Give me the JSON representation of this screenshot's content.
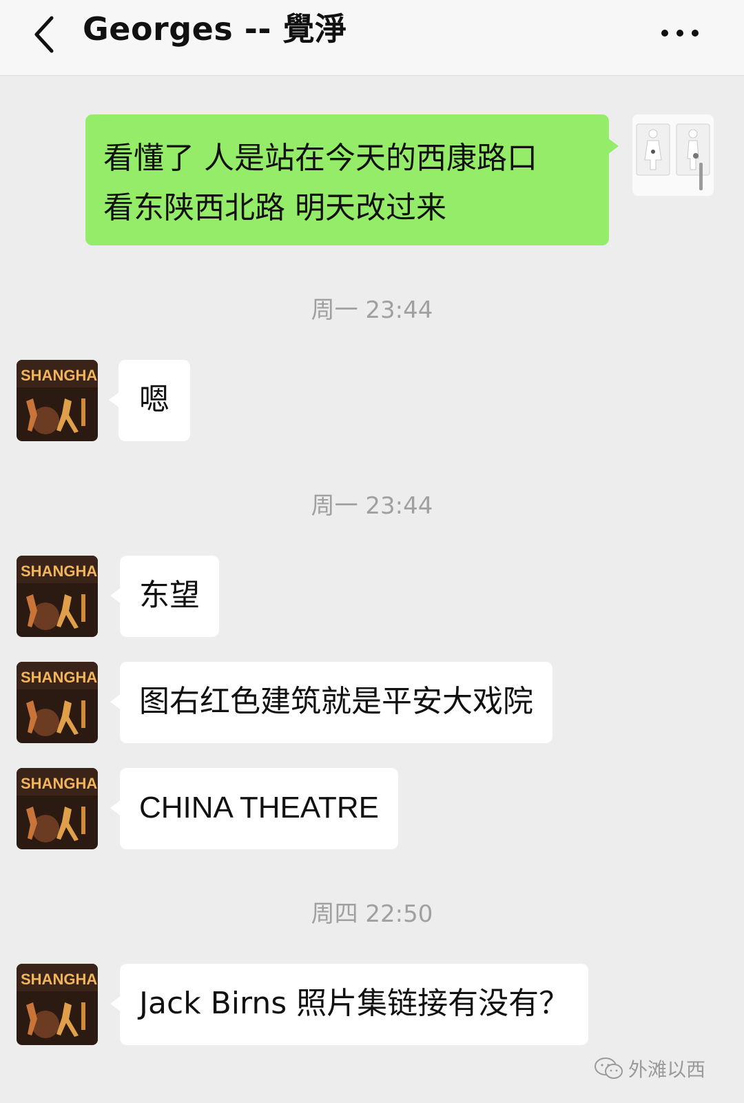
{
  "header": {
    "back_icon": "chevron-left-icon",
    "title": "Georges -- 覺淨",
    "more_icon": "more-dots-icon"
  },
  "messages": [
    {
      "type": "sent",
      "lines": [
        "看懂了 人是站在今天的西康路口",
        "看东陕西北路 明天改过来"
      ]
    },
    {
      "type": "timestamp",
      "text": "周一 23:44"
    },
    {
      "type": "received",
      "text": "嗯"
    },
    {
      "type": "timestamp",
      "text": "周一 23:44"
    },
    {
      "type": "received",
      "text": "东望"
    },
    {
      "type": "received",
      "text": "图右红色建筑就是平安大戏院"
    },
    {
      "type": "received",
      "text": "CHINA THEATRE"
    },
    {
      "type": "timestamp",
      "text": "周四 22:50"
    },
    {
      "type": "received",
      "text": "Jack Birns 照片集链接有没有？"
    }
  ],
  "avatar": {
    "label": "SHANGHAI"
  },
  "watermark": {
    "text": "外滩以西",
    "icon": "wechat-icon"
  },
  "colors": {
    "sent_bubble": "#95ec69",
    "received_bubble": "#ffffff",
    "background": "#ededed"
  }
}
